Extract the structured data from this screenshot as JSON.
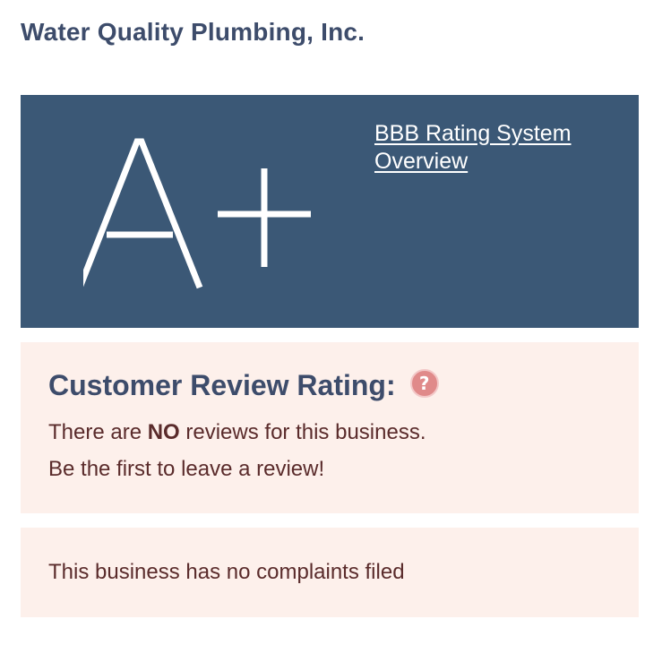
{
  "business": {
    "name": "Water Quality Plumbing, Inc."
  },
  "rating": {
    "grade": "A+",
    "link_label": "BBB Rating System Overview",
    "background_color": "#3b5876"
  },
  "reviews": {
    "heading": "Customer Review Rating:",
    "help_icon": "question-mark-icon",
    "line1_prefix": "There are ",
    "line1_emphasis": "NO",
    "line1_suffix": " reviews for this business.",
    "line2": "Be the first to leave a review!",
    "background_color": "#fdf0eb"
  },
  "complaints": {
    "text": "This business has no complaints filed"
  }
}
